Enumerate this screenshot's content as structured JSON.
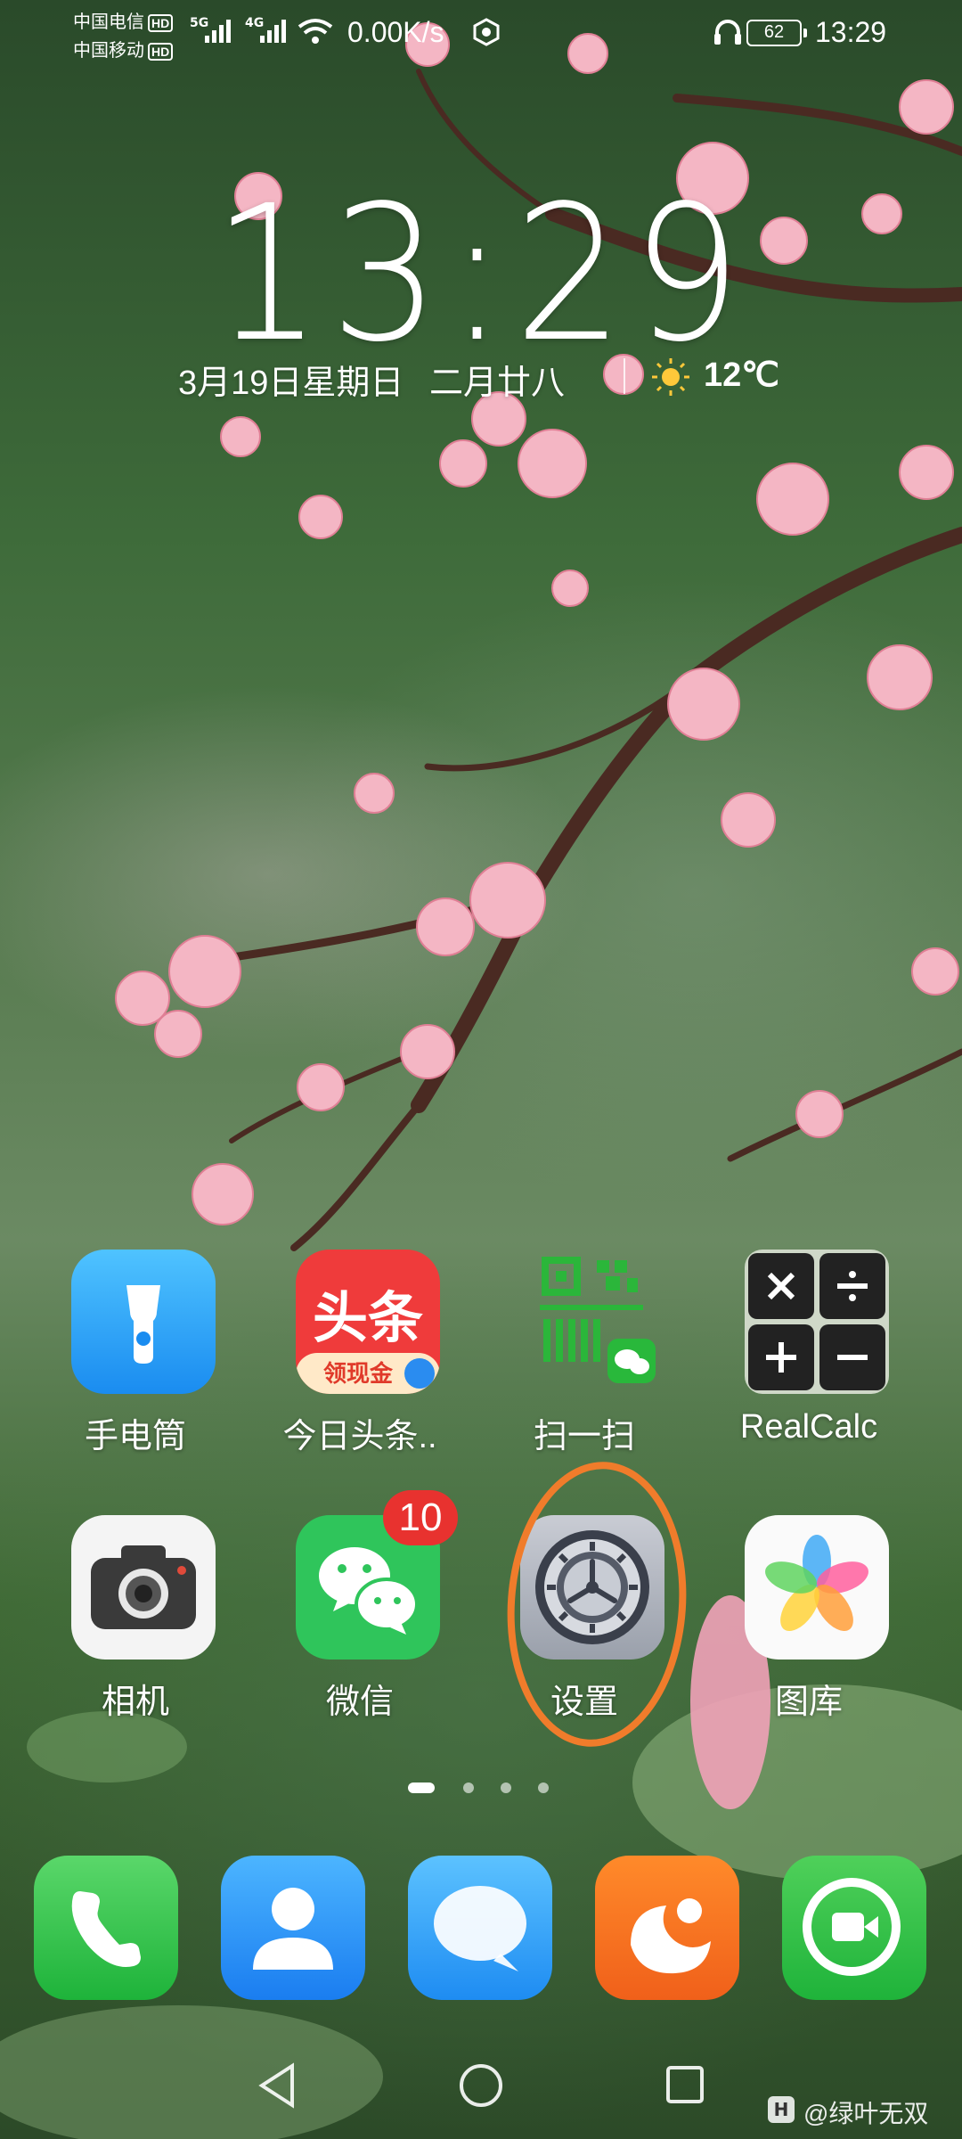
{
  "status_bar": {
    "carrier1": "中国电信",
    "carrier2": "中国移动",
    "hd_label": "HD",
    "net1": "5G",
    "net2": "4G",
    "net_speed": "0.00K/s",
    "battery": "62",
    "time": "13:29"
  },
  "lockscreen": {
    "clock": "13:29",
    "date": "3月19日星期日",
    "lunar": "二月廿八",
    "temperature": "12℃",
    "weather_icon": "sun-icon"
  },
  "apps_row1": [
    {
      "label": "手电筒",
      "icon": "flashlight-icon"
    },
    {
      "label": "今日头条..",
      "icon": "toutiao-icon",
      "icon_text": "头条",
      "icon_subtext": "领现金"
    },
    {
      "label": "扫一扫",
      "icon": "qr-scan-icon"
    },
    {
      "label": "RealCalc",
      "icon": "calculator-icon"
    }
  ],
  "apps_row2": [
    {
      "label": "相机",
      "icon": "camera-icon"
    },
    {
      "label": "微信",
      "icon": "wechat-icon",
      "badge": "10"
    },
    {
      "label": "设置",
      "icon": "settings-gear-icon"
    },
    {
      "label": "图库",
      "icon": "gallery-icon"
    }
  ],
  "dock": [
    {
      "icon": "phone-icon"
    },
    {
      "icon": "contacts-icon"
    },
    {
      "icon": "messages-icon"
    },
    {
      "icon": "uc-browser-icon"
    },
    {
      "icon": "video-call-icon"
    }
  ],
  "page_indicator": {
    "pages": 4,
    "current": 1
  },
  "watermark": "@绿叶无双",
  "colors": {
    "highlight_circle": "#f07c2b",
    "badge": "#e8322f"
  }
}
